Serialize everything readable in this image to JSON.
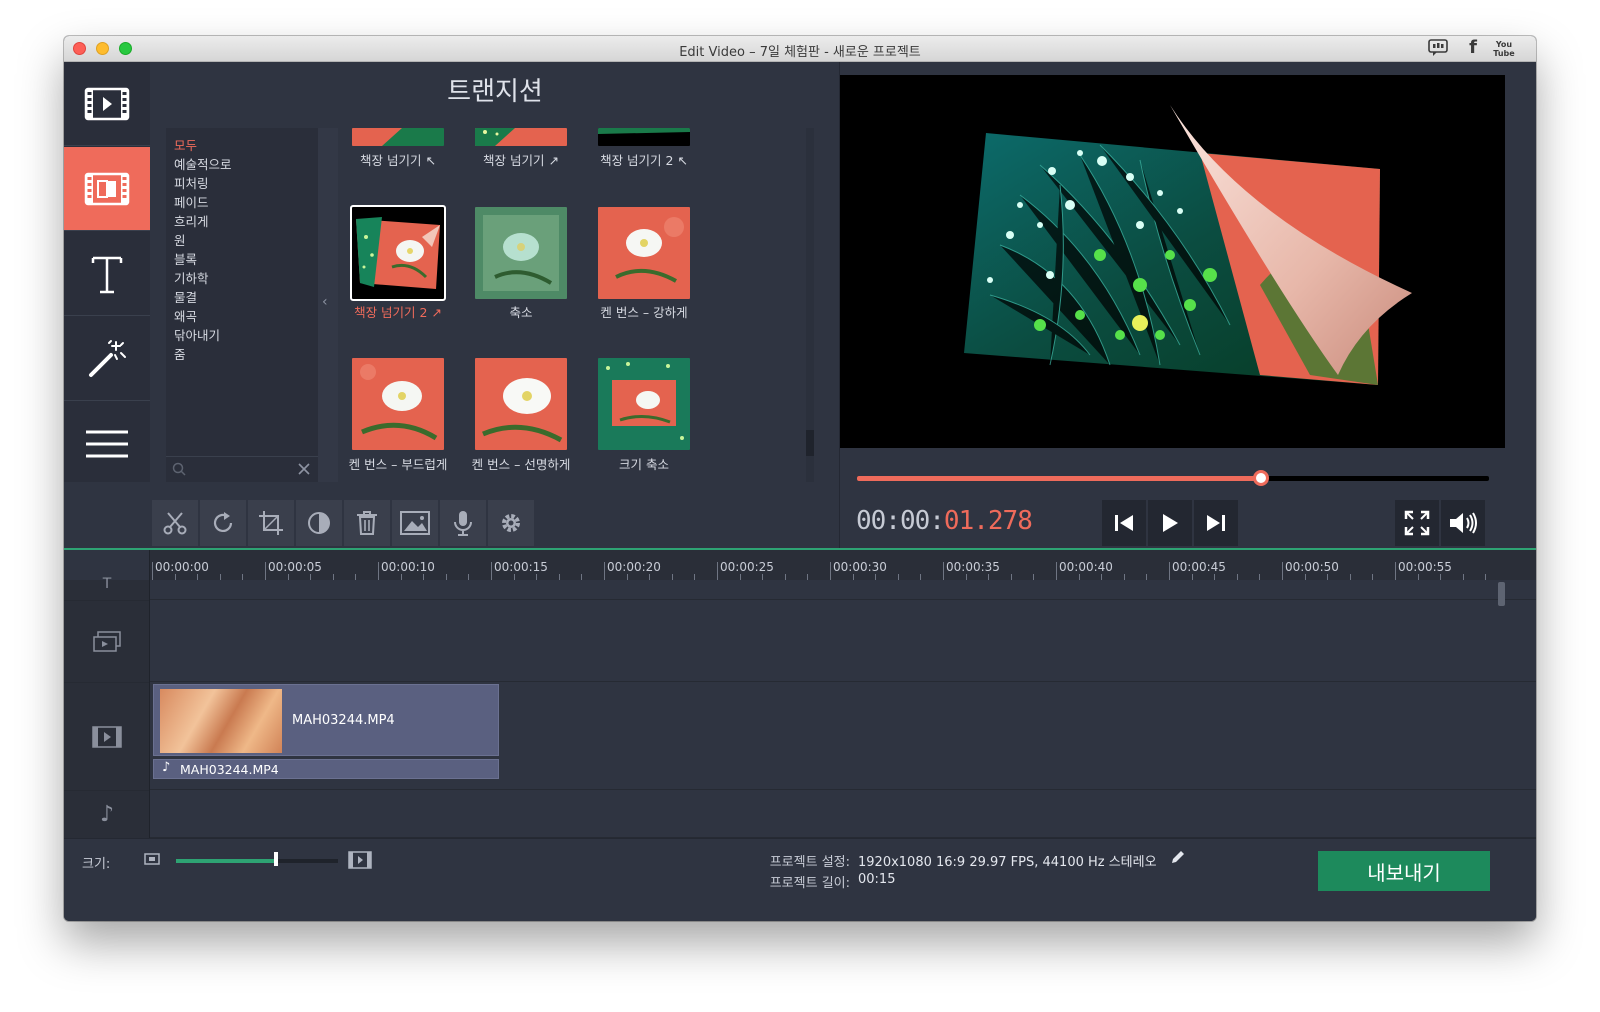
{
  "window": {
    "title": "Edit Video – 7일 체험판 - 새로운 프로젝트",
    "social_icons": [
      "speech-bubble-icon",
      "facebook-icon",
      "youtube-icon"
    ],
    "youtube_text": "You Tube"
  },
  "leftnav": {
    "items": [
      {
        "name": "media",
        "icon": "film-icon",
        "active": false
      },
      {
        "name": "transitions",
        "icon": "transition-film-icon",
        "active": true
      },
      {
        "name": "titles",
        "icon": "text-T-icon",
        "active": false
      },
      {
        "name": "filters",
        "icon": "magic-wand-icon",
        "active": false
      },
      {
        "name": "more",
        "icon": "hamburger-menu-icon",
        "active": false
      }
    ]
  },
  "transitions": {
    "title": "트랜지션",
    "categories": [
      "모두",
      "예술적으로",
      "피처링",
      "페이드",
      "흐리게",
      "원",
      "블록",
      "기하학",
      "물결",
      "왜곡",
      "닦아내기",
      "줌"
    ],
    "active_category": 0,
    "items": [
      {
        "label": "책장 넘기기 ↖",
        "selected": false
      },
      {
        "label": "책장 넘기기 ↗",
        "selected": false
      },
      {
        "label": "책장 넘기기 2 ↖",
        "selected": false
      },
      {
        "label": "책장 넘기기 2 ↗",
        "selected": true
      },
      {
        "label": "축소",
        "selected": false
      },
      {
        "label": "켄 번스 – 강하게",
        "selected": false
      },
      {
        "label": "켄 번스 – 부드럽게",
        "selected": false
      },
      {
        "label": "켄 번스 – 선명하게",
        "selected": false
      },
      {
        "label": "크기 축소",
        "selected": false
      }
    ]
  },
  "toolbar": {
    "tools": [
      "scissors-icon",
      "rotate-icon",
      "crop-icon",
      "color-adjust-icon",
      "trash-icon",
      "image-icon",
      "microphone-icon",
      "gear-icon"
    ]
  },
  "player": {
    "timecode_main": "00:00:",
    "timecode_highlight": "01.278",
    "progress": 0.64,
    "controls": [
      "skip-back-icon",
      "play-icon",
      "skip-forward-icon"
    ],
    "right_controls": [
      "fullscreen-icon",
      "volume-icon"
    ]
  },
  "timeline": {
    "ticks": [
      "00:00:00",
      "00:00:05",
      "00:00:10",
      "00:00:15",
      "00:00:20",
      "00:00:25",
      "00:00:30",
      "00:00:35",
      "00:00:40",
      "00:00:45",
      "00:00:50",
      "00:00:55"
    ],
    "video_clip": "MAH03244.MP4",
    "audio_clip": "MAH03244.MP4",
    "track_icons": [
      "text-track-icon",
      "overlay-track-icon",
      "video-track-icon",
      "audio-track-icon"
    ]
  },
  "bottom": {
    "size_label": "크기:",
    "zoom_level": 0.62,
    "project_settings_label": "프로젝트 설정:",
    "project_settings_value": "1920x1080 16:9 29.97 FPS, 44100 Hz 스테레오",
    "project_length_label": "프로젝트 길이:",
    "project_length_value": "00:15",
    "export_label": "내보내기"
  },
  "colors": {
    "accent": "#ef6b5b",
    "export_green": "#1d8a5c",
    "timeline_green": "#2ea373",
    "panel_bg": "#2f3441"
  }
}
